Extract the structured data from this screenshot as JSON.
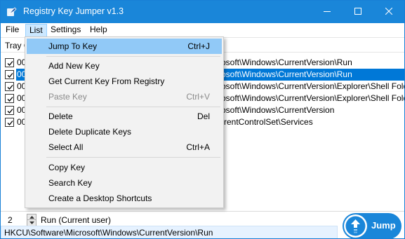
{
  "window": {
    "title": "Registry Key Jumper v1.3",
    "accent": "#1a86d9"
  },
  "menubar": {
    "items": [
      "File",
      "List",
      "Settings",
      "Help"
    ],
    "active": "List"
  },
  "list": {
    "header": "Tray C",
    "rows": [
      {
        "num": "00",
        "path": "osoft\\Windows\\CurrentVersion\\Run",
        "checked": true,
        "selected": false
      },
      {
        "num": "00",
        "path": "osoft\\Windows\\CurrentVersion\\Run",
        "checked": true,
        "selected": true
      },
      {
        "num": "00",
        "path": "osoft\\Windows\\CurrentVersion\\Explorer\\Shell Folders",
        "checked": true,
        "selected": false
      },
      {
        "num": "00",
        "path": "osoft\\Windows\\CurrentVersion\\Explorer\\Shell Folders",
        "checked": true,
        "selected": false
      },
      {
        "num": "00",
        "path": "osoft\\Windows\\CurrentVersion",
        "checked": true,
        "selected": false
      },
      {
        "num": "00",
        "path": "rrentControlSet\\Services",
        "checked": true,
        "selected": false
      }
    ]
  },
  "dropdown": {
    "items": [
      {
        "label": "Jump To Key",
        "shortcut": "Ctrl+J",
        "highlight": true,
        "disabled": false
      },
      {
        "label": "Add New Key",
        "shortcut": "",
        "highlight": false,
        "disabled": false
      },
      {
        "label": "Get Current Key From Registry",
        "shortcut": "",
        "highlight": false,
        "disabled": false
      },
      {
        "label": "Paste Key",
        "shortcut": "Ctrl+V",
        "highlight": false,
        "disabled": true
      },
      {
        "label": "Delete",
        "shortcut": "Del",
        "highlight": false,
        "disabled": false
      },
      {
        "label": "Delete Duplicate Keys",
        "shortcut": "",
        "highlight": false,
        "disabled": false
      },
      {
        "label": "Select All",
        "shortcut": "Ctrl+A",
        "highlight": false,
        "disabled": false
      },
      {
        "label": "Copy Key",
        "shortcut": "",
        "highlight": false,
        "disabled": false
      },
      {
        "label": "Search Key",
        "shortcut": "",
        "highlight": false,
        "disabled": false
      },
      {
        "label": "Create a Desktop Shortcuts",
        "shortcut": "",
        "highlight": false,
        "disabled": false
      }
    ]
  },
  "bottom": {
    "count": "2",
    "preset_name": "Run (Current user)",
    "path_value": "HKCU\\Software\\Microsoft\\Windows\\CurrentVersion\\Run",
    "jump_label": "Jump"
  }
}
